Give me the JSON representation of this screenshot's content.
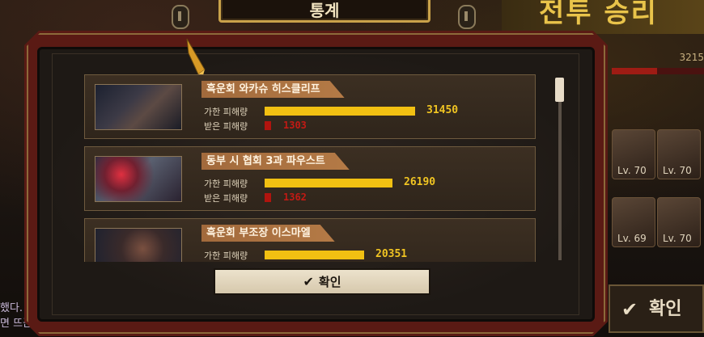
{
  "background": {
    "banner_text": "통계",
    "title_text": "전투 승리",
    "score_text": "3215",
    "cards": [
      {
        "level": "Lv. 70"
      },
      {
        "level": "Lv. 70"
      },
      {
        "level": "Lv. 69"
      },
      {
        "level": "Lv. 70"
      }
    ],
    "confirm_label": "확인",
    "chat_lines": [
      "했다. !",
      "면 뜨끈"
    ]
  },
  "modal": {
    "characters": [
      {
        "name": "흑운회 와카슈 히스클리프",
        "dealt_label": "가한 피해량",
        "dealt": "31450",
        "dealt_fraction": 0.59,
        "received_label": "받은 피해량",
        "received": "1303",
        "received_fraction": 0.025,
        "portrait": "heathcliff"
      },
      {
        "name": "동부 시 협회 3과 파우스트",
        "dealt_label": "가한 피해량",
        "dealt": "26190",
        "dealt_fraction": 0.5,
        "received_label": "받은 피해량",
        "received": "1362",
        "received_fraction": 0.025,
        "portrait": "faust"
      },
      {
        "name": "흑운회 부조장 이스마엘",
        "dealt_label": "가한 피해량",
        "dealt": "20351",
        "dealt_fraction": 0.39,
        "received_label": "받은 피해량",
        "received": "",
        "received_fraction": 0,
        "portrait": "ishmael"
      }
    ],
    "scroll_fraction": 0.0,
    "confirm_label": "확인"
  },
  "colors": {
    "dealt_bar": "#f2c012",
    "received_bar": "#b0140e",
    "name_tag": "#a26a3c"
  }
}
